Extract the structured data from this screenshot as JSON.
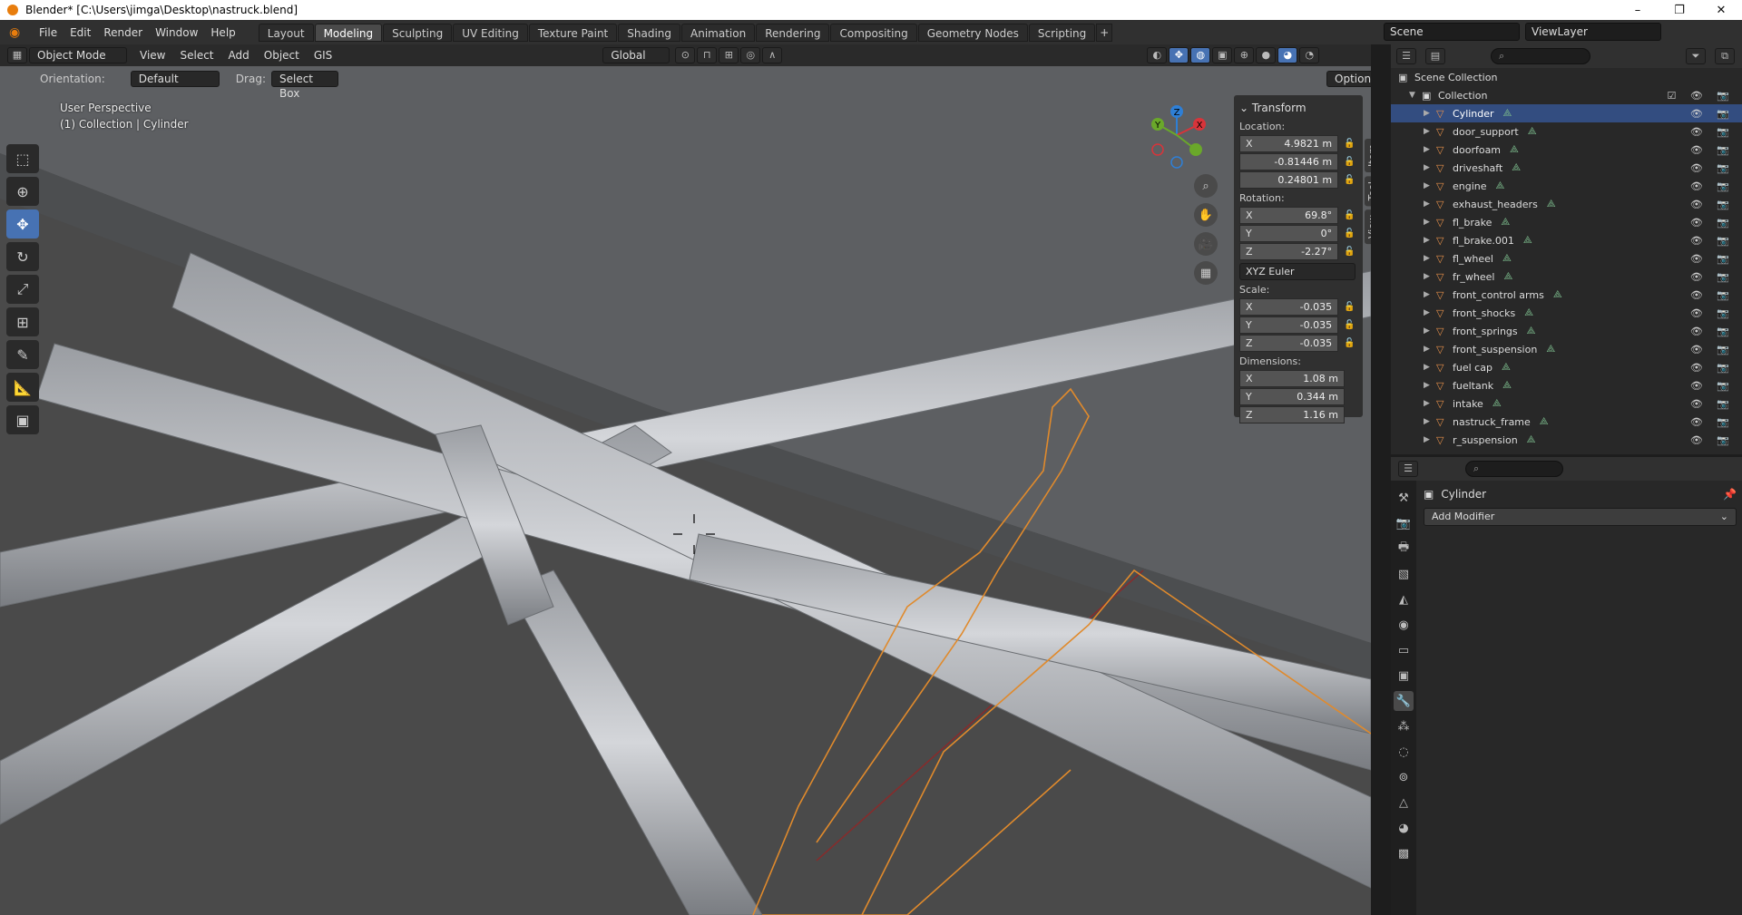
{
  "window": {
    "title": "Blender* [C:\\Users\\jimga\\Desktop\\nastruck.blend]",
    "minimize": "–",
    "maximize": "❐",
    "close": "✕"
  },
  "menu": [
    "File",
    "Edit",
    "Render",
    "Window",
    "Help"
  ],
  "workspaces": [
    "Layout",
    "Modeling",
    "Sculpting",
    "UV Editing",
    "Texture Paint",
    "Shading",
    "Animation",
    "Rendering",
    "Compositing",
    "Geometry Nodes",
    "Scripting"
  ],
  "workspace_active": "Modeling",
  "scene": {
    "name": "Scene",
    "view_layer": "ViewLayer"
  },
  "viewport": {
    "mode": "Object Mode",
    "header_menu": [
      "View",
      "Select",
      "Add",
      "Object",
      "GIS"
    ],
    "transform_space": "Global",
    "orientation_label": "Orientation:",
    "orientation": "Default",
    "drag_label": "Drag:",
    "drag": "Select Box",
    "options": "Options",
    "info_line1": "User Perspective",
    "info_line2": "(1) Collection | Cylinder",
    "gizmo": {
      "x": "X",
      "y": "Y",
      "z": "Z"
    }
  },
  "npanel": {
    "header": "Transform",
    "location_label": "Location:",
    "location": [
      {
        "axis": "X",
        "value": "4.9821 m"
      },
      {
        "axis": "",
        "value": "-0.81446 m"
      },
      {
        "axis": "",
        "value": "0.24801 m"
      }
    ],
    "rotation_label": "Rotation:",
    "rotation": [
      {
        "axis": "X",
        "value": "69.8°"
      },
      {
        "axis": "Y",
        "value": "0°"
      },
      {
        "axis": "Z",
        "value": "-2.27°"
      }
    ],
    "rotation_mode": "XYZ Euler",
    "scale_label": "Scale:",
    "scale": [
      {
        "axis": "X",
        "value": "-0.035"
      },
      {
        "axis": "Y",
        "value": "-0.035"
      },
      {
        "axis": "Z",
        "value": "-0.035"
      }
    ],
    "dimensions_label": "Dimensions:",
    "dimensions": [
      {
        "axis": "X",
        "value": "1.08 m"
      },
      {
        "axis": "Y",
        "value": "0.344 m"
      },
      {
        "axis": "Z",
        "value": "1.16 m"
      }
    ],
    "tabs": [
      "Item",
      "Tool",
      "View"
    ]
  },
  "outliner": {
    "root": "Scene Collection",
    "collection": "Collection",
    "items": [
      "Cylinder",
      "door_support",
      "doorfoam",
      "driveshaft",
      "engine",
      "exhaust_headers",
      "fl_brake",
      "fl_brake.001",
      "fl_wheel",
      "fr_wheel",
      "front_control arms",
      "front_shocks",
      "front_springs",
      "front_suspension",
      "fuel cap",
      "fueltank",
      "intake",
      "nastruck_frame",
      "r_suspension"
    ],
    "selected": "Cylinder"
  },
  "properties": {
    "object": "Cylinder",
    "add_modifier": "Add Modifier"
  }
}
